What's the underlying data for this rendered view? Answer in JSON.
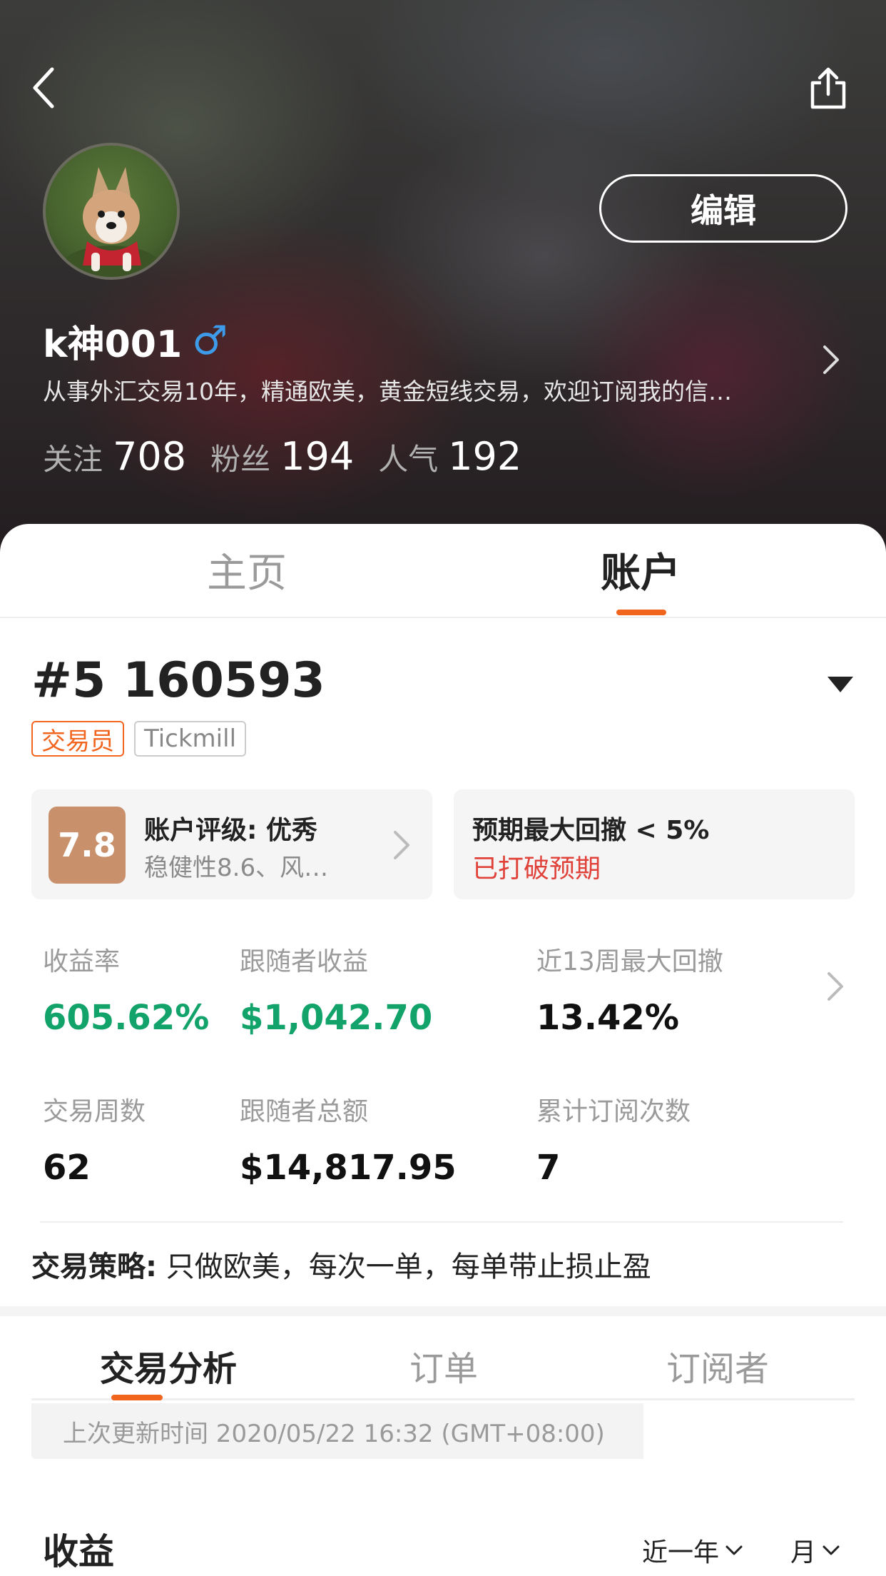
{
  "header": {
    "edit_label": "编辑",
    "username": "k神001",
    "gender_symbol": "♂",
    "bio": "从事外汇交易10年，精通欧美，黄金短线交易，欢迎订阅我的信…",
    "stats": [
      {
        "label": "关注",
        "value": "708"
      },
      {
        "label": "粉丝",
        "value": "194"
      },
      {
        "label": "人气",
        "value": "192"
      }
    ]
  },
  "tabs": {
    "home": "主页",
    "account": "账户"
  },
  "account": {
    "number": "#5 160593",
    "tags": {
      "role": "交易员",
      "broker": "Tickmill"
    },
    "rating": {
      "score": "7.8",
      "title": "账户评级: 优秀",
      "subtitle": "稳健性8.6、风…"
    },
    "drawdown": {
      "title": "预期最大回撤 < 5%",
      "status": "已打破预期"
    },
    "metrics": [
      {
        "label": "收益率",
        "value": "605.62%"
      },
      {
        "label": "跟随者收益",
        "value": "$1,042.70"
      },
      {
        "label": "近13周最大回撤",
        "value": "13.42%"
      },
      {
        "label": "交易周数",
        "value": "62"
      },
      {
        "label": "跟随者总额",
        "value": "$14,817.95"
      },
      {
        "label": "累计订阅次数",
        "value": "7"
      }
    ],
    "strategy_label": "交易策略:",
    "strategy_text": "只做欧美，每次一单，每单带止损止盈"
  },
  "subtabs": {
    "analysis": "交易分析",
    "orders": "订单",
    "subscribers": "订阅者"
  },
  "update_text": "上次更新时间 2020/05/22 16:32 (GMT+08:00)",
  "earnings": {
    "title": "收益",
    "period": "近一年",
    "unit": "月"
  },
  "colors": {
    "accent": "#f2651f",
    "positive": "#12a36a",
    "warning": "#e0423a",
    "rating_badge": "#c8906b"
  }
}
